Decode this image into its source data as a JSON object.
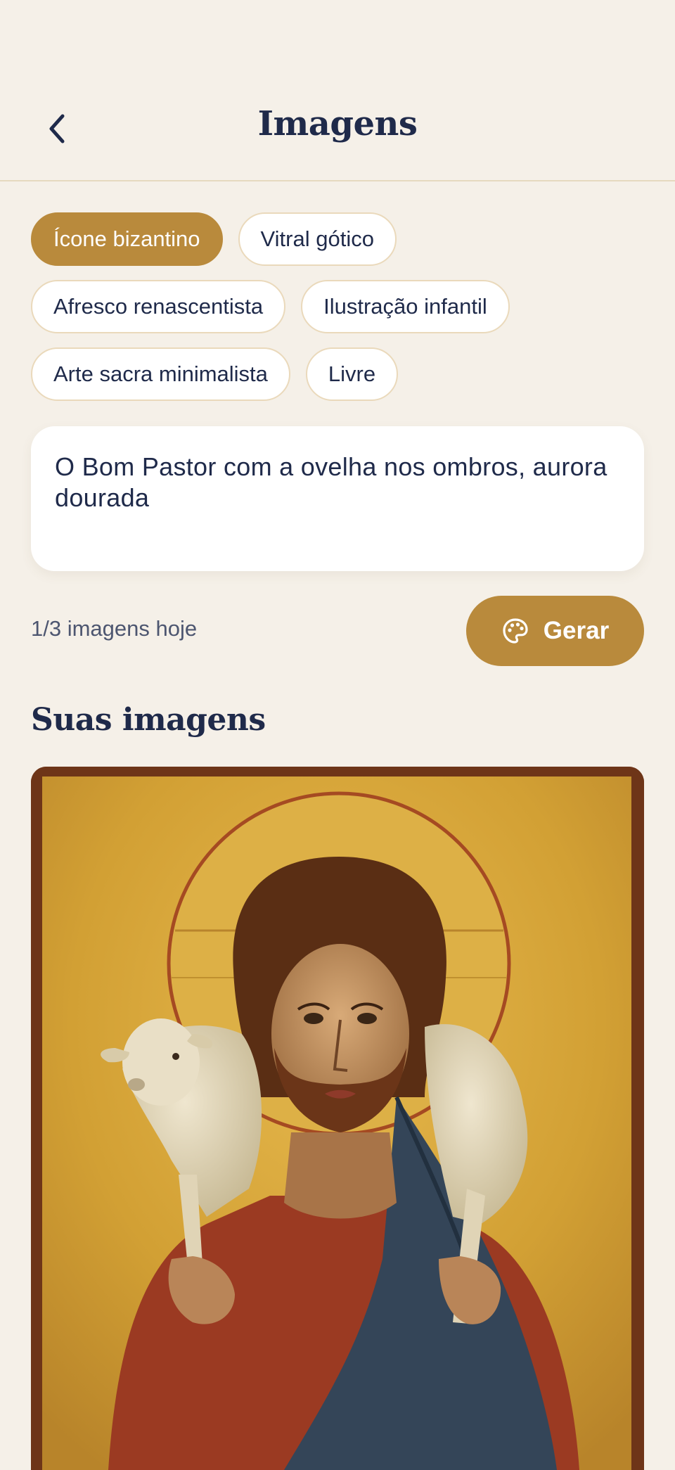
{
  "header": {
    "title": "Imagens",
    "back_icon": "chevron-left-icon"
  },
  "styles": {
    "items": [
      {
        "label": "Ícone bizantino",
        "active": true
      },
      {
        "label": "Vitral gótico",
        "active": false
      },
      {
        "label": "Afresco renascentista",
        "active": false
      },
      {
        "label": "Ilustração infantil",
        "active": false
      },
      {
        "label": "Arte sacra minimalista",
        "active": false
      },
      {
        "label": "Livre",
        "active": false
      }
    ]
  },
  "prompt": {
    "value": "O Bom Pastor com a ovelha nos ombros, aurora dourada"
  },
  "quota": {
    "text": "1/3 imagens hoje"
  },
  "generate": {
    "label": "Gerar",
    "icon": "palette-icon"
  },
  "gallery": {
    "title": "Suas imagens"
  },
  "colors": {
    "accent": "#b98a3c",
    "background": "#f5f0e8",
    "text": "#1f2a4a"
  }
}
